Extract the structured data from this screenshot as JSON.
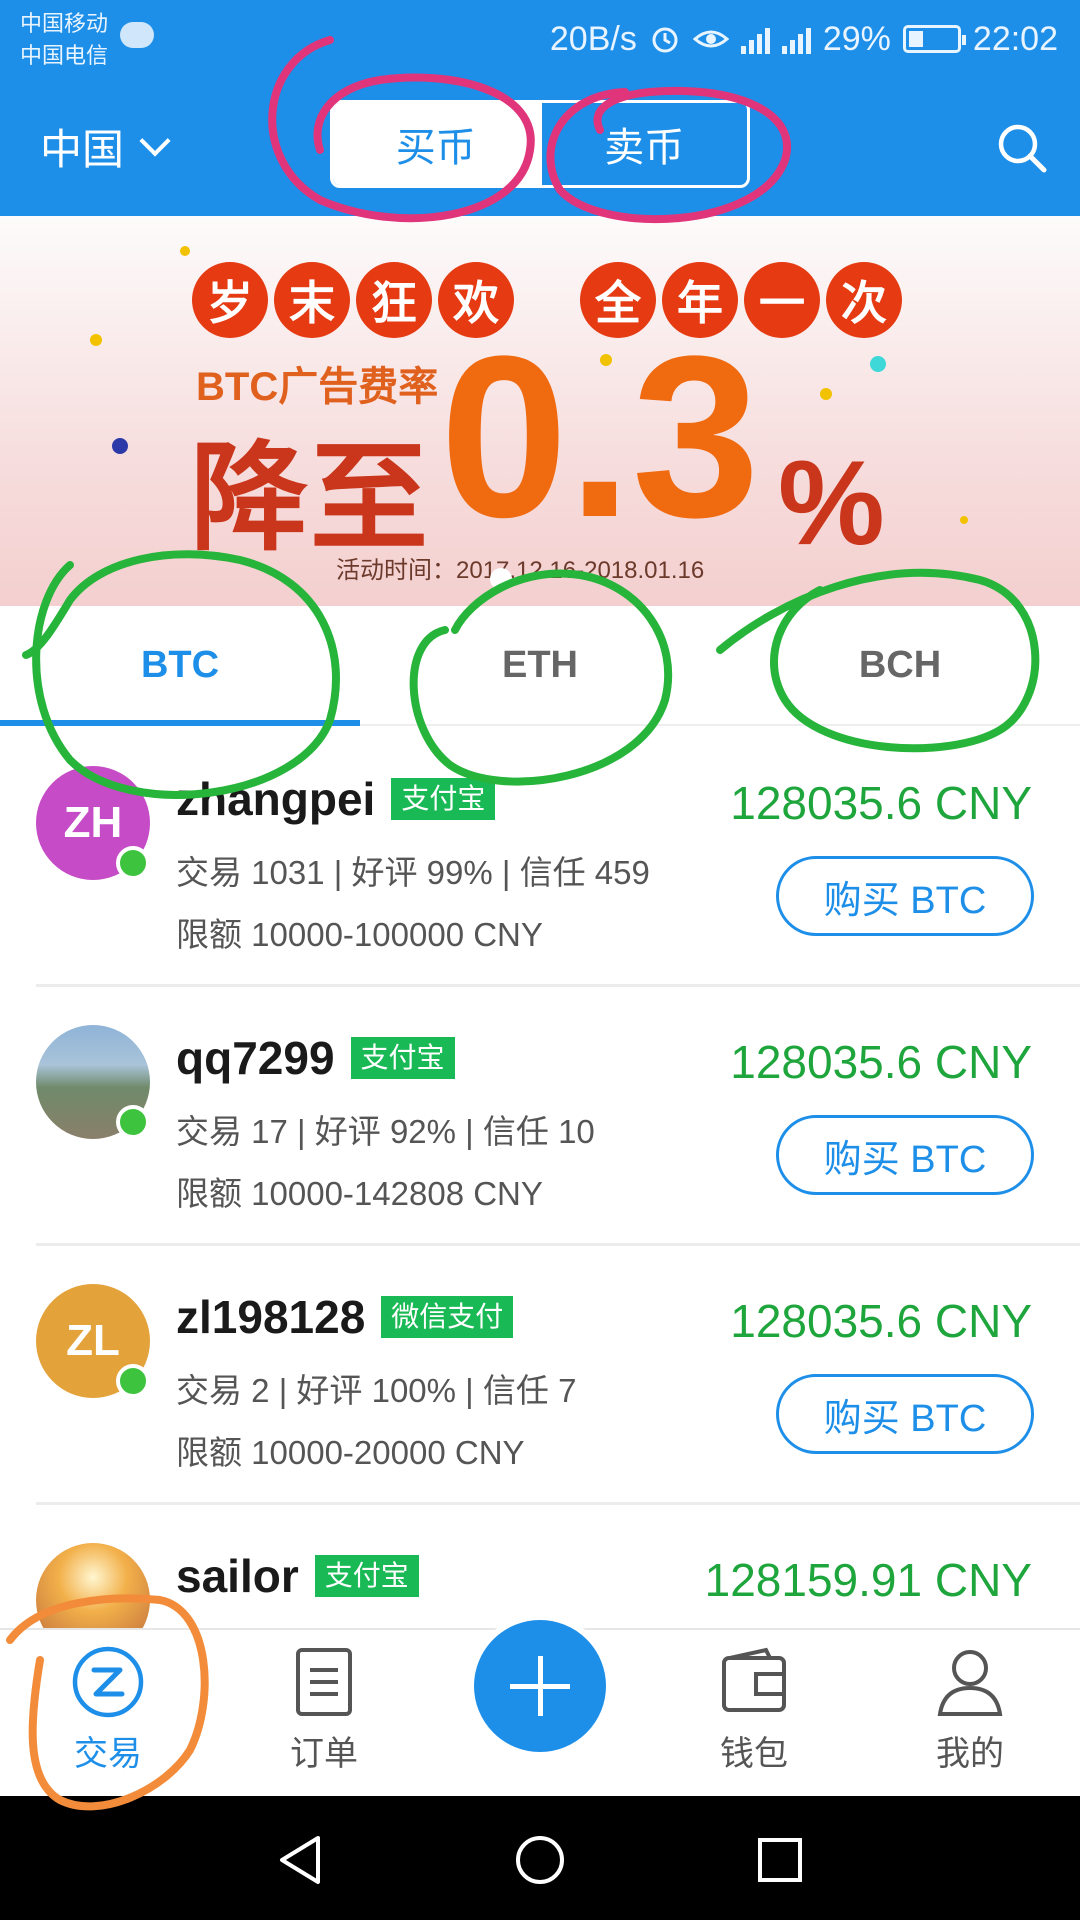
{
  "status_bar": {
    "carrier_1": "中国移动",
    "carrier_2": "中国电信",
    "net_speed": "20B/s",
    "battery": "29%",
    "time": "22:02"
  },
  "header": {
    "region": "中国",
    "segments": [
      "买币",
      "卖币"
    ],
    "active_segment": 0
  },
  "banner": {
    "circles_left": [
      "岁",
      "末",
      "狂",
      "欢"
    ],
    "circles_right": [
      "全",
      "年",
      "一",
      "次"
    ],
    "subtitle": "BTC广告费率",
    "big_text": "降至",
    "rate": "0.3",
    "rate_symbol": "%",
    "date": "活动时间：2017.12.16-2018.01.16"
  },
  "tabs": [
    {
      "label": "BTC",
      "active": true
    },
    {
      "label": "ETH",
      "active": false
    },
    {
      "label": "BCH",
      "active": false
    }
  ],
  "listings": [
    {
      "initials": "ZH",
      "avatar_color": "#c64bc6",
      "username": "zhangpei",
      "payment": "支付宝",
      "stats": "交易 1031 | 好评 99% | 信任 459",
      "limit": "限额 10000-100000 CNY",
      "price": "128035.6 CNY",
      "button": "购买 BTC"
    },
    {
      "initials": "",
      "avatar_color": "#6f8a6a",
      "username": "qq7299",
      "payment": "支付宝",
      "stats": "交易 17 | 好评 92% | 信任 10",
      "limit": "限额 10000-142808 CNY",
      "price": "128035.6 CNY",
      "button": "购买 BTC"
    },
    {
      "initials": "ZL",
      "avatar_color": "#e3a23a",
      "username": "zl198128",
      "payment": "微信支付",
      "stats": "交易 2 | 好评 100% | 信任 7",
      "limit": "限额 10000-20000 CNY",
      "price": "128035.6 CNY",
      "button": "购买 BTC"
    },
    {
      "initials": "",
      "avatar_color": "#e8a05a",
      "username": "sailor",
      "payment": "支付宝",
      "stats": "",
      "limit": "",
      "price": "128159.91 CNY",
      "button": ""
    }
  ],
  "bottom_nav": [
    {
      "label": "交易",
      "icon": "trade-icon",
      "active": true
    },
    {
      "label": "订单",
      "icon": "orders-icon",
      "active": false
    },
    {
      "label": "",
      "icon": "plus-icon",
      "active": false
    },
    {
      "label": "钱包",
      "icon": "wallet-icon",
      "active": false
    },
    {
      "label": "我的",
      "icon": "profile-icon",
      "active": false
    }
  ],
  "colors": {
    "primary": "#1e8fe9",
    "price_green": "#1ea53c",
    "badge_green": "#19b955",
    "annotation_pink": "#e0357a",
    "annotation_green": "#27b43a",
    "annotation_orange": "#f28c3a"
  }
}
